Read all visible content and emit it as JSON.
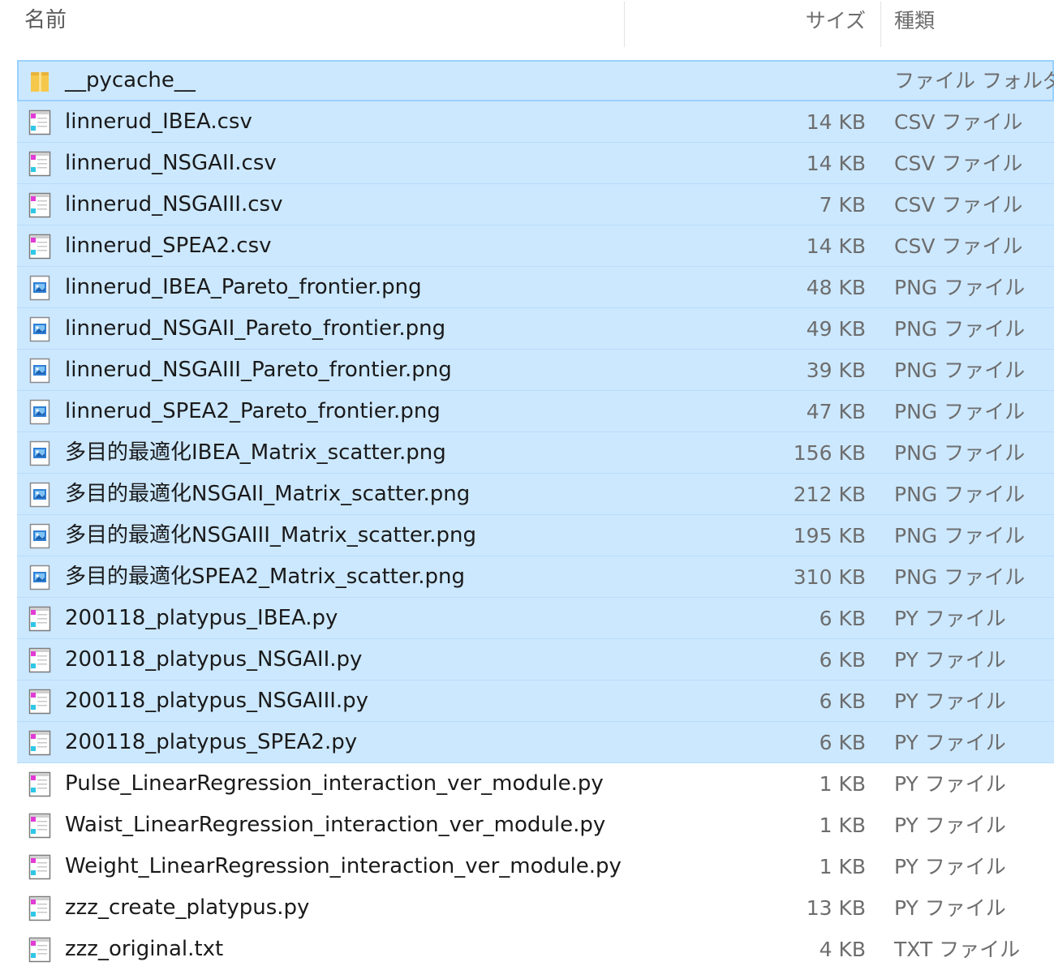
{
  "columns": {
    "name": "名前",
    "size": "サイズ",
    "type": "種類"
  },
  "files": [
    {
      "name": "__pycache__",
      "size": "",
      "type": "ファイル フォルダー",
      "icon": "folder-icon",
      "selected": true,
      "focused": true
    },
    {
      "name": "linnerud_IBEA.csv",
      "size": "14 KB",
      "type": "CSV ファイル",
      "icon": "file-icon",
      "selected": true
    },
    {
      "name": "linnerud_NSGAII.csv",
      "size": "14 KB",
      "type": "CSV ファイル",
      "icon": "file-icon",
      "selected": true
    },
    {
      "name": "linnerud_NSGAIII.csv",
      "size": "7 KB",
      "type": "CSV ファイル",
      "icon": "file-icon",
      "selected": true
    },
    {
      "name": "linnerud_SPEA2.csv",
      "size": "14 KB",
      "type": "CSV ファイル",
      "icon": "file-icon",
      "selected": true
    },
    {
      "name": "linnerud_IBEA_Pareto_frontier.png",
      "size": "48 KB",
      "type": "PNG ファイル",
      "icon": "image-icon",
      "selected": true
    },
    {
      "name": "linnerud_NSGAII_Pareto_frontier.png",
      "size": "49 KB",
      "type": "PNG ファイル",
      "icon": "image-icon",
      "selected": true
    },
    {
      "name": "linnerud_NSGAIII_Pareto_frontier.png",
      "size": "39 KB",
      "type": "PNG ファイル",
      "icon": "image-icon",
      "selected": true
    },
    {
      "name": "linnerud_SPEA2_Pareto_frontier.png",
      "size": "47 KB",
      "type": "PNG ファイル",
      "icon": "image-icon",
      "selected": true
    },
    {
      "name": "多目的最適化IBEA_Matrix_scatter.png",
      "size": "156 KB",
      "type": "PNG ファイル",
      "icon": "image-icon",
      "selected": true
    },
    {
      "name": "多目的最適化NSGAII_Matrix_scatter.png",
      "size": "212 KB",
      "type": "PNG ファイル",
      "icon": "image-icon",
      "selected": true
    },
    {
      "name": "多目的最適化NSGAIII_Matrix_scatter.png",
      "size": "195 KB",
      "type": "PNG ファイル",
      "icon": "image-icon",
      "selected": true
    },
    {
      "name": "多目的最適化SPEA2_Matrix_scatter.png",
      "size": "310 KB",
      "type": "PNG ファイル",
      "icon": "image-icon",
      "selected": true
    },
    {
      "name": "200118_platypus_IBEA.py",
      "size": "6 KB",
      "type": "PY ファイル",
      "icon": "file-icon",
      "selected": true
    },
    {
      "name": "200118_platypus_NSGAII.py",
      "size": "6 KB",
      "type": "PY ファイル",
      "icon": "file-icon",
      "selected": true
    },
    {
      "name": "200118_platypus_NSGAIII.py",
      "size": "6 KB",
      "type": "PY ファイル",
      "icon": "file-icon",
      "selected": true
    },
    {
      "name": "200118_platypus_SPEA2.py",
      "size": "6 KB",
      "type": "PY ファイル",
      "icon": "file-icon",
      "selected": true
    },
    {
      "name": "Pulse_LinearRegression_interaction_ver_module.py",
      "size": "1 KB",
      "type": "PY ファイル",
      "icon": "file-icon",
      "selected": false
    },
    {
      "name": "Waist_LinearRegression_interaction_ver_module.py",
      "size": "1 KB",
      "type": "PY ファイル",
      "icon": "file-icon",
      "selected": false
    },
    {
      "name": "Weight_LinearRegression_interaction_ver_module.py",
      "size": "1 KB",
      "type": "PY ファイル",
      "icon": "file-icon",
      "selected": false
    },
    {
      "name": "zzz_create_platypus.py",
      "size": "13 KB",
      "type": "PY ファイル",
      "icon": "file-icon",
      "selected": false
    },
    {
      "name": "zzz_original.txt",
      "size": "4 KB",
      "type": "TXT ファイル",
      "icon": "file-icon",
      "selected": false
    }
  ],
  "colors": {
    "selection": "#cce8ff",
    "selection_border": "#99d1ff",
    "folder": "#f5c84c"
  }
}
